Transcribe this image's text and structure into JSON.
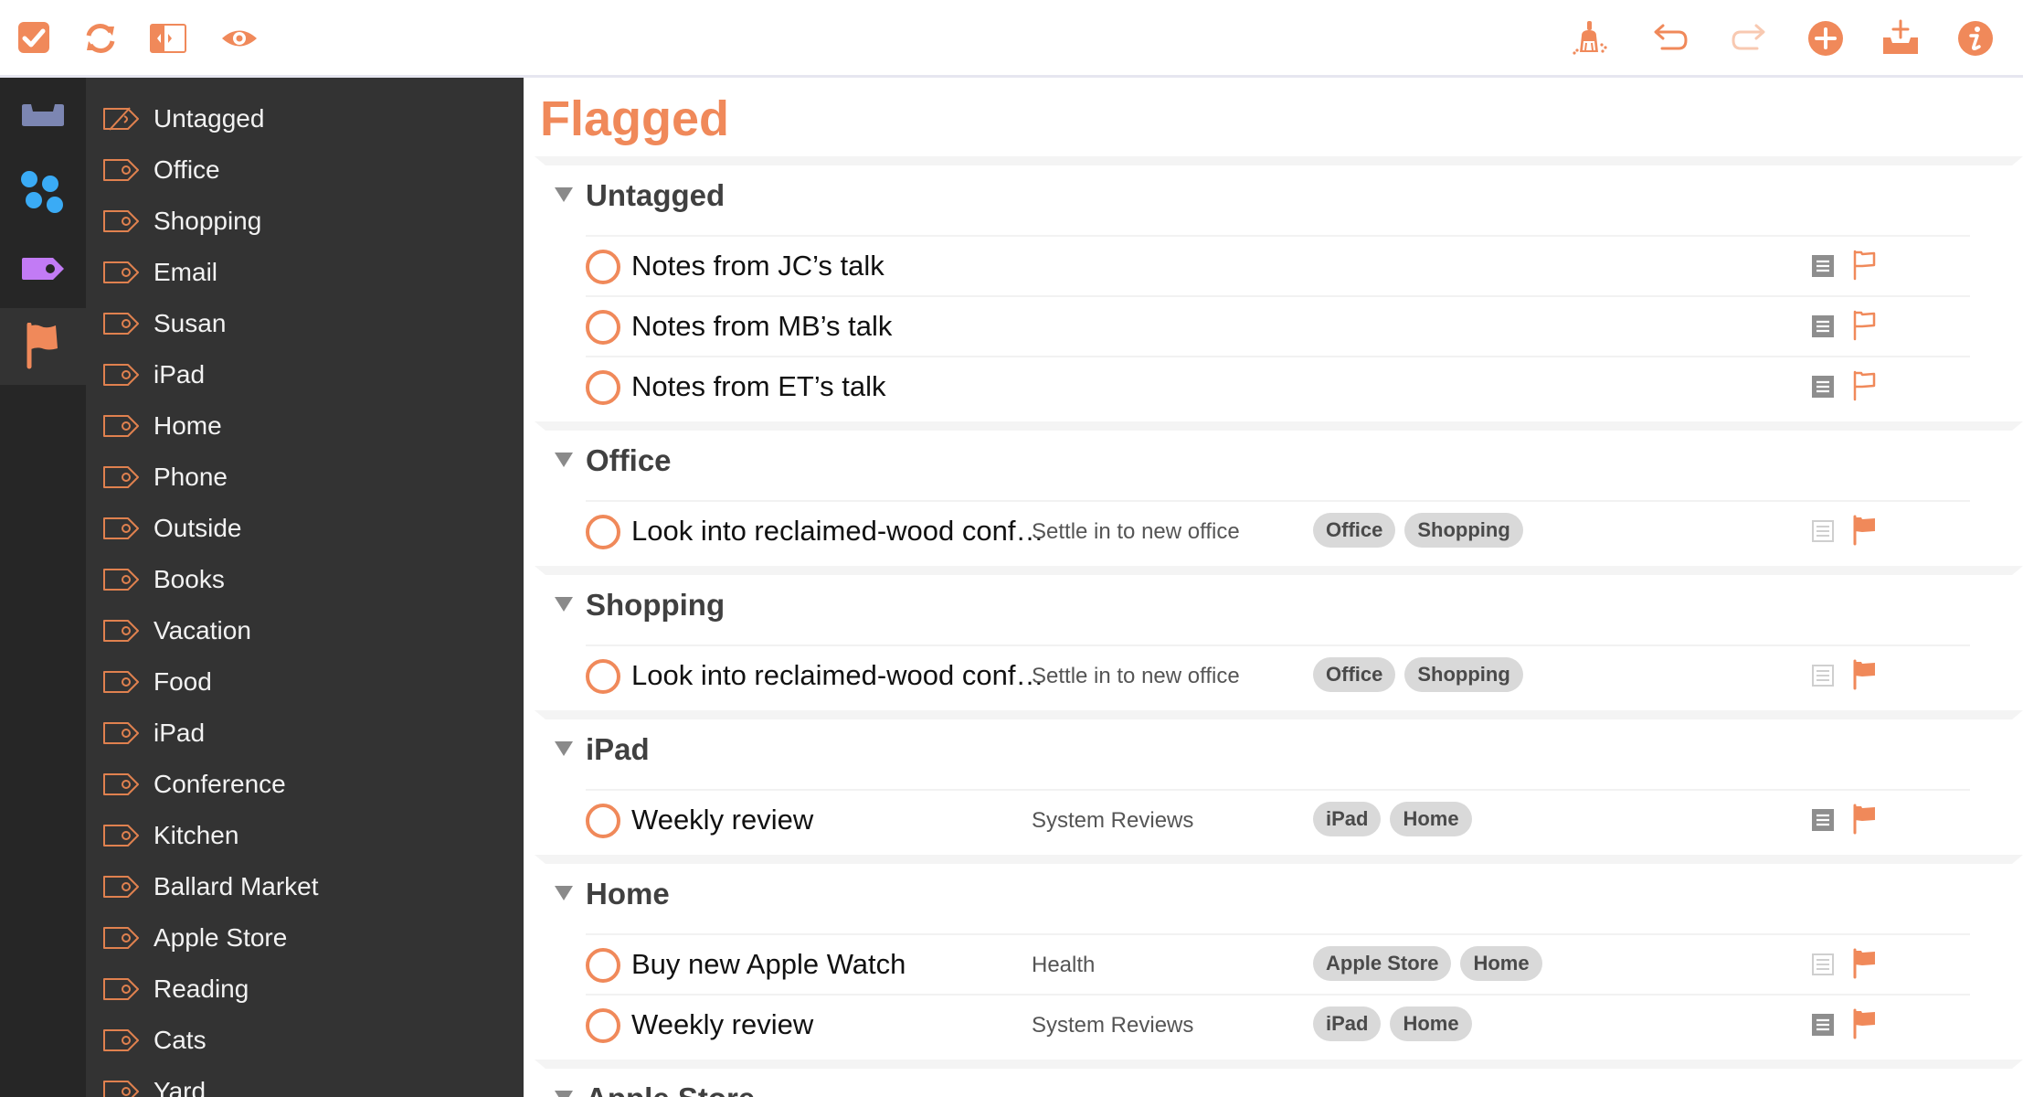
{
  "toolbar": {
    "left": [
      {
        "icon": "checkbox-icon",
        "label": "Complete"
      },
      {
        "icon": "sync-icon",
        "label": "Sync"
      },
      {
        "icon": "sidebar-toggle-icon",
        "label": "Toggle Sidebar"
      },
      {
        "icon": "eye-icon",
        "label": "View Options"
      }
    ],
    "right": [
      {
        "icon": "clean-up-icon",
        "label": "Clean Up"
      },
      {
        "icon": "undo-icon",
        "label": "Undo"
      },
      {
        "icon": "redo-icon",
        "label": "Redo",
        "disabled": true
      },
      {
        "icon": "add-icon",
        "label": "New Action"
      },
      {
        "icon": "quick-entry-icon",
        "label": "Quick Entry"
      },
      {
        "icon": "info-icon",
        "label": "Inspector"
      }
    ]
  },
  "perspectives": [
    {
      "name": "Inbox",
      "icon": "inbox-icon",
      "color": "#7C86B2"
    },
    {
      "name": "Projects",
      "icon": "projects-icon",
      "color": "#3AABF5"
    },
    {
      "name": "Tags",
      "icon": "tag-icon",
      "color": "#C27BF5"
    },
    {
      "name": "Flagged",
      "icon": "flag-icon",
      "color": "#F0895A",
      "selected": true
    }
  ],
  "tags": [
    {
      "label": "Untagged",
      "icon": "untagged-icon"
    },
    {
      "label": "Office",
      "icon": "tag-icon"
    },
    {
      "label": "Shopping",
      "icon": "tag-icon"
    },
    {
      "label": "Email",
      "icon": "tag-icon"
    },
    {
      "label": "Susan",
      "icon": "tag-icon"
    },
    {
      "label": "iPad",
      "icon": "tag-icon"
    },
    {
      "label": "Home",
      "icon": "tag-icon"
    },
    {
      "label": "Phone",
      "icon": "tag-icon"
    },
    {
      "label": "Outside",
      "icon": "tag-icon"
    },
    {
      "label": "Books",
      "icon": "tag-icon"
    },
    {
      "label": "Vacation",
      "icon": "tag-icon"
    },
    {
      "label": "Food",
      "icon": "tag-icon"
    },
    {
      "label": "iPad",
      "icon": "tag-icon"
    },
    {
      "label": "Conference",
      "icon": "tag-icon"
    },
    {
      "label": "Kitchen",
      "icon": "tag-icon"
    },
    {
      "label": "Ballard Market",
      "icon": "tag-icon"
    },
    {
      "label": "Apple Store",
      "icon": "tag-icon"
    },
    {
      "label": "Reading",
      "icon": "tag-icon"
    },
    {
      "label": "Cats",
      "icon": "tag-icon"
    },
    {
      "label": "Yard",
      "icon": "tag-icon"
    }
  ],
  "main": {
    "title": "Flagged",
    "accent": "#F0895A",
    "groups": [
      {
        "title": "Untagged",
        "rows": [
          {
            "title": "Notes from JC’s talk",
            "project": "",
            "tags": [],
            "has_note": true,
            "flag": "inherited"
          },
          {
            "title": "Notes from MB’s talk",
            "project": "",
            "tags": [],
            "has_note": true,
            "flag": "inherited"
          },
          {
            "title": "Notes from ET’s talk",
            "project": "",
            "tags": [],
            "has_note": true,
            "flag": "inherited"
          }
        ]
      },
      {
        "title": "Office",
        "rows": [
          {
            "title": "Look into reclaimed-wood conf…",
            "project": "Settle in to new office",
            "tags": [
              "Office",
              "Shopping"
            ],
            "has_note": false,
            "flag": "flagged"
          }
        ]
      },
      {
        "title": "Shopping",
        "rows": [
          {
            "title": "Look into reclaimed-wood conf…",
            "project": "Settle in to new office",
            "tags": [
              "Office",
              "Shopping"
            ],
            "has_note": false,
            "flag": "flagged"
          }
        ]
      },
      {
        "title": "iPad",
        "rows": [
          {
            "title": "Weekly review",
            "project": "System Reviews",
            "tags": [
              "iPad",
              "Home"
            ],
            "has_note": true,
            "flag": "flagged"
          }
        ]
      },
      {
        "title": "Home",
        "rows": [
          {
            "title": "Buy new Apple Watch",
            "project": "Health",
            "tags": [
              "Apple Store",
              "Home"
            ],
            "has_note": false,
            "flag": "flagged"
          },
          {
            "title": "Weekly review",
            "project": "System Reviews",
            "tags": [
              "iPad",
              "Home"
            ],
            "has_note": true,
            "flag": "flagged"
          }
        ]
      },
      {
        "title": "Apple Store",
        "rows": []
      }
    ]
  }
}
